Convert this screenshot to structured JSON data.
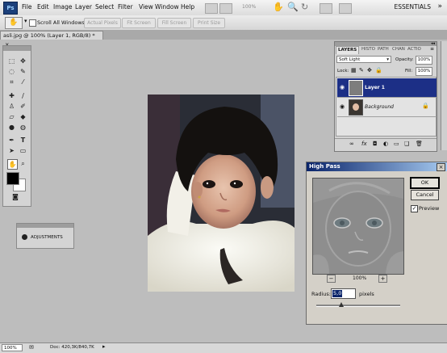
{
  "app": {
    "logo": "Ps"
  },
  "menu": [
    "File",
    "Edit",
    "Image",
    "Layer",
    "Select",
    "Filter",
    "View",
    "Window",
    "Help"
  ],
  "zoom_menu_value": "100%",
  "workspace": "ESSENTIALS",
  "options": {
    "scroll_all_windows": "Scroll All Windows",
    "actual_pixels": "Actual Pixels",
    "fit_screen": "Fit Screen",
    "fill_screen": "Fill Screen",
    "print_size": "Print Size"
  },
  "document_tab": {
    "title": "asli.jpg @ 100% (Layer 1, RGB/8) *",
    "close": "×"
  },
  "adjustments": {
    "label": "ADJUSTMENTS"
  },
  "layers": {
    "tabs": [
      "LAYERS",
      "HISTO",
      "PATH",
      "CHAN",
      "ACTIO"
    ],
    "blend_mode": "Soft Light",
    "opacity_label": "Opacity:",
    "opacity_value": "100%",
    "lock_label": "Lock:",
    "fill_label": "Fill:",
    "fill_value": "100%",
    "rows": [
      {
        "name": "Layer 1",
        "selected": true
      },
      {
        "name": "Background",
        "selected": false
      }
    ]
  },
  "high_pass": {
    "title": "High Pass",
    "ok": "OK",
    "cancel": "Cancel",
    "preview": "Preview",
    "zoom": "100%",
    "radius_label": "Radius:",
    "radius_value": "5,0",
    "units": "pixels",
    "slider_fraction": 0.3
  },
  "status": {
    "zoom": "100%",
    "doc": "Doc: 420,3K/840,7K"
  },
  "colors": {
    "accent": "#0a246a",
    "selected_layer": "#1c2f86"
  }
}
